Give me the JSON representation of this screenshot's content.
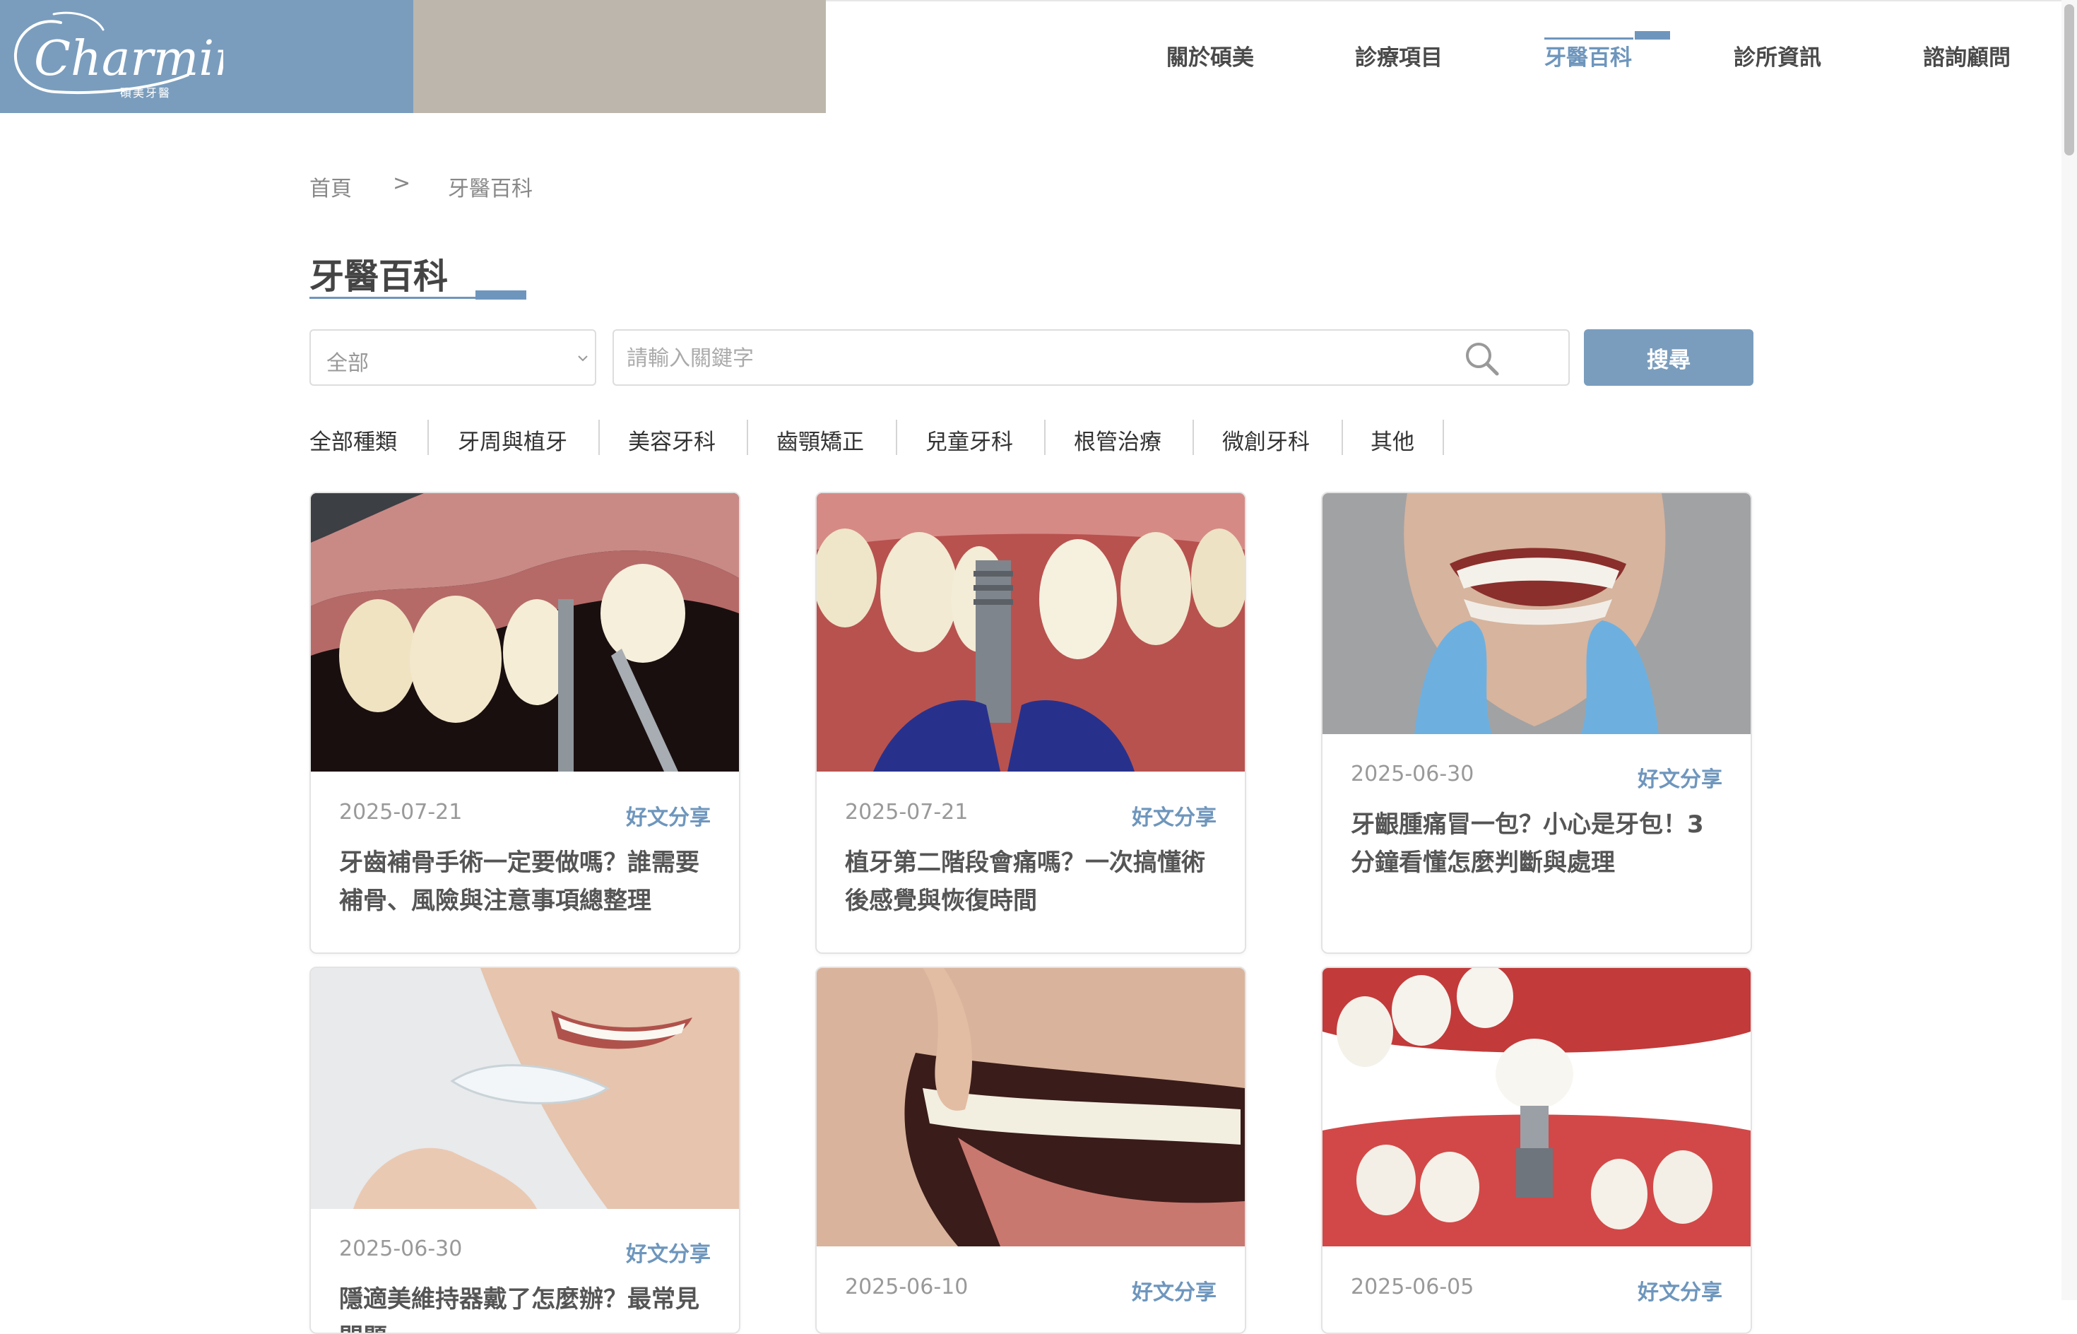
{
  "header": {
    "logo_text": "Charming",
    "logo_sub": "碩美牙醫",
    "nav": [
      {
        "label": "關於碩美",
        "active": false
      },
      {
        "label": "診療項目",
        "active": false
      },
      {
        "label": "牙醫百科",
        "active": true
      },
      {
        "label": "診所資訊",
        "active": false
      },
      {
        "label": "諮詢顧問",
        "active": false
      }
    ]
  },
  "breadcrumb": {
    "home": "首頁",
    "separator": ">",
    "current": "牙醫百科"
  },
  "page_title": "牙醫百科",
  "search": {
    "category_value": "全部",
    "placeholder": "請輸入關鍵字",
    "value": "",
    "button_label": "搜尋"
  },
  "categories": [
    "全部種類",
    "牙周與植牙",
    "美容牙科",
    "齒顎矯正",
    "兒童牙科",
    "根管治療",
    "微創牙科",
    "其他"
  ],
  "cards": [
    {
      "date": "2025-07-21",
      "tag": "好文分享",
      "title": "牙齒補骨手術一定要做嗎？誰需要補骨、風險與注意事項總整理"
    },
    {
      "date": "2025-07-21",
      "tag": "好文分享",
      "title": "植牙第二階段會痛嗎？一次搞懂術後感覺與恢復時間"
    },
    {
      "date": "2025-06-30",
      "tag": "好文分享",
      "title": "牙齦腫痛冒一包？小心是牙包！3分鐘看懂怎麼判斷與處理"
    },
    {
      "date": "2025-06-30",
      "tag": "好文分享",
      "title": "隱適美維持器戴了怎麼辦？最常見問題"
    },
    {
      "date": "2025-06-10",
      "tag": "好文分享",
      "title": ""
    },
    {
      "date": "2025-06-05",
      "tag": "好文分享",
      "title": ""
    }
  ],
  "colors": {
    "accent": "#6e96bd",
    "logo_bg": "#7a9dbd",
    "tan": "#bcb6ad"
  }
}
